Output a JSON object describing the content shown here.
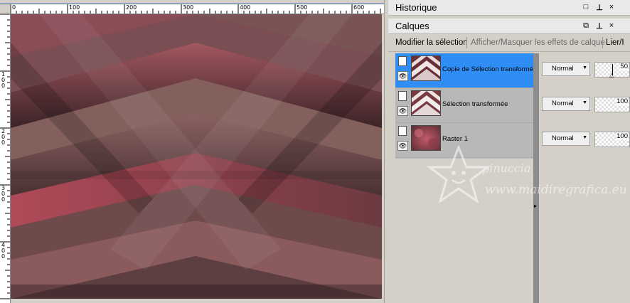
{
  "ruler": {
    "horizontal_labels": [
      "0",
      "100",
      "200",
      "300",
      "400",
      "500",
      "600"
    ],
    "vertical_labels": [
      "1\n0\n0",
      "2\n0\n0",
      "3\n0\n0",
      "4\n0\n0"
    ]
  },
  "panels": {
    "history": {
      "title": "Historique"
    },
    "layers": {
      "title": "Calques",
      "toolbar": {
        "edit_selection": "Modifier la sélection",
        "toggle_effects": "Afficher/Masquer les effets de calque",
        "link": "Lier/I"
      },
      "items": [
        {
          "name": "Copie de Sélection transformée",
          "blend": "Normal",
          "opacity": "50",
          "selected": true
        },
        {
          "name": "Sélection transformée",
          "blend": "Normal",
          "opacity": "100",
          "selected": false
        },
        {
          "name": "Raster 1",
          "blend": "Normal",
          "opacity": "100",
          "selected": false
        }
      ]
    }
  },
  "window_controls": {
    "restore": "□",
    "pin": "ꟷ",
    "close": "×"
  },
  "watermark": {
    "line1": "pinuccia",
    "line2": "www.maidiregrafica.eu"
  },
  "colors": {
    "selected_row": "#2f8ef5",
    "panel_bg": "#d4d0c8",
    "canvas_rose": "#9a4a56",
    "canvas_dark": "#3c2628"
  }
}
